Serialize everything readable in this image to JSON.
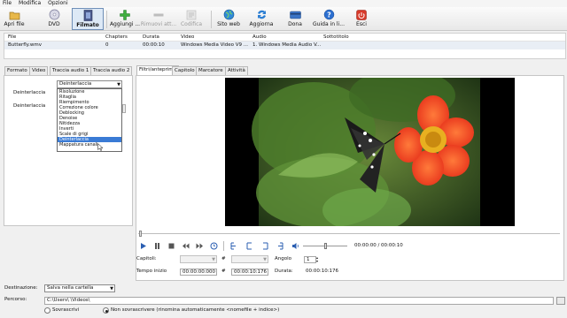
{
  "menu": [
    "File",
    "Modifica",
    "Opzioni"
  ],
  "toolbar": {
    "items": [
      {
        "label": "Apri file",
        "icon": "open-file-icon"
      },
      {
        "label": "DVD",
        "icon": "dvd-icon"
      },
      {
        "label": "Filmato",
        "icon": "film-icon"
      },
      {
        "label": "Aggiungi ...",
        "icon": "add-icon"
      },
      {
        "label": "Rimuovi att...",
        "icon": "remove-icon"
      },
      {
        "label": "Codifica",
        "icon": "encode-icon"
      },
      {
        "label": "Sito web",
        "icon": "globe-icon"
      },
      {
        "label": "Aggiorna",
        "icon": "refresh-icon"
      },
      {
        "label": "Dona",
        "icon": "donate-icon"
      },
      {
        "label": "Guida in li...",
        "icon": "help-icon"
      },
      {
        "label": "Esci",
        "icon": "exit-icon"
      }
    ]
  },
  "filetable": {
    "headers": [
      "File",
      "Chapters",
      "Durata",
      "Video",
      "Audio",
      "Sottotitolo"
    ],
    "row": [
      "Butterfly.wmv",
      "0",
      "00:00:10",
      "Windows Media Video V9 ...",
      "1. Windows Media Audio V...",
      ""
    ]
  },
  "tabs_left": [
    "Formato",
    "Video",
    "Traccia audio 1",
    "Traccia audio 2"
  ],
  "tabs_right": [
    "Filtri/anteprima",
    "Capitolo",
    "Marcatore",
    "Attività"
  ],
  "filters": {
    "label1": "Deinterlaccia",
    "label2": "Deinterlaccia",
    "selected": "Deinterlaccia",
    "options": [
      "Risoluzione",
      "Ritaglia",
      "Riempimento",
      "Correzione colore",
      "Deblocking",
      "Denoise",
      "Nitidezza",
      "Inverti",
      "Scale di grigi",
      "Deinterlaccia",
      "Mappatura canali"
    ]
  },
  "player": {
    "time": "00:00:00 / 00:00:10"
  },
  "chapters": {
    "capitoli_label": "Capitoli:",
    "angle_label": "Angolo",
    "angle_value": "1",
    "start_label": "Tempo inizio",
    "start_value": "00:00:00:000",
    "end_value": "00:00:10:176",
    "durata_label": "Durata:",
    "durata_value": "00:00:10:176",
    "hash": "#"
  },
  "bottom": {
    "dest_label": "Destinazione:",
    "dest_value": "Salva nella cartella",
    "path_label": "Percorso:",
    "path_value": "C:\\Users\\         \\Videos\\",
    "radio1": "Sovrascrivi",
    "radio2": "Non sovrascrivere (rinomina automaticamente <nomefile + indice>)"
  },
  "colors": {
    "accent": "#3a7bd5",
    "toolbar_active": "#dde9f6"
  }
}
